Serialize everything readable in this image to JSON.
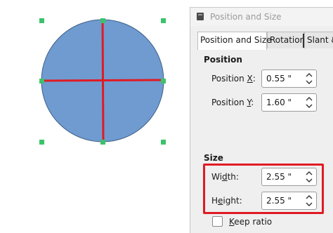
{
  "colors": {
    "circle_fill": "#6f9bd1",
    "circle_stroke": "#3f5f86",
    "axis_line": "#e01b24",
    "handle": "#3cc26c",
    "highlight": "#e01b24"
  },
  "dialog": {
    "title": "Position and Size",
    "tabs": [
      {
        "label": "Position and Size",
        "active": true
      },
      {
        "label": "Rotation",
        "active": false
      },
      {
        "label": "Slant &",
        "active": false
      }
    ],
    "position": {
      "heading": "Position",
      "x_label_pre": "Position ",
      "x_label_key": "X",
      "x_label_post": ":",
      "x_value": "0.55 \"",
      "y_label_pre": "Position ",
      "y_label_key": "Y",
      "y_label_post": ":",
      "y_value": "1.60 \""
    },
    "size": {
      "heading": "Size",
      "width_label_pre": "Wi",
      "width_label_key": "d",
      "width_label_post": "th:",
      "width_value": "2.55 \"",
      "height_label_pre": "H",
      "height_label_key": "e",
      "height_label_post": "ight:",
      "height_value": "2.55 \""
    },
    "keep_ratio": {
      "label_key": "K",
      "label_rest": "eep ratio",
      "checked": false
    }
  }
}
